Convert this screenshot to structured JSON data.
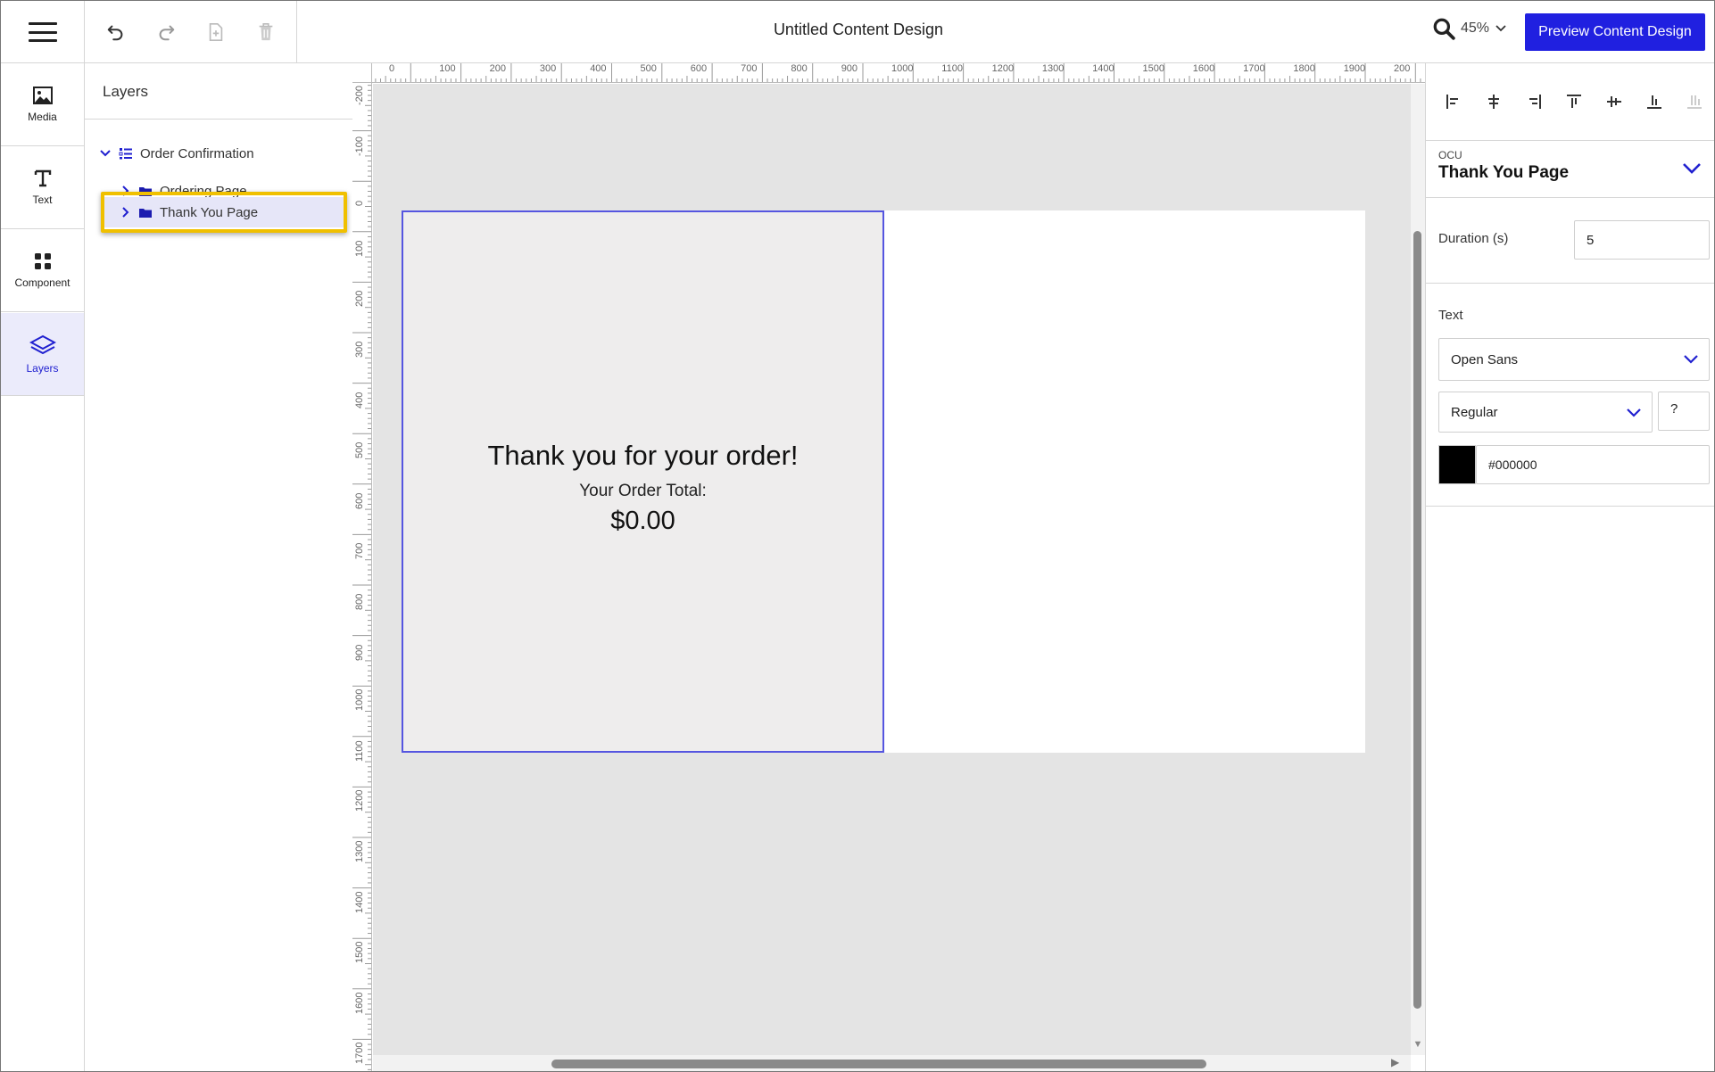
{
  "app": {
    "document_title": "Untitled Content Design",
    "zoom_level": "45%",
    "preview_button": "Preview Content Design"
  },
  "toolbar": {
    "undo_icon": "undo-icon",
    "redo_icon": "redo-icon",
    "new_page_icon": "new-page-icon",
    "delete_icon": "trash-icon"
  },
  "sidebar": {
    "items": [
      {
        "label": "Media",
        "icon": "image-icon"
      },
      {
        "label": "Text",
        "icon": "text-icon"
      },
      {
        "label": "Component",
        "icon": "grid-icon"
      },
      {
        "label": "Layers",
        "icon": "layers-icon",
        "active": true
      }
    ]
  },
  "layers_panel": {
    "title": "Layers",
    "tree": [
      {
        "label": "Order Confirmation",
        "expanded": true,
        "icon": "sequence-icon"
      },
      {
        "label": "Ordering Page",
        "expanded": false,
        "icon": "folder-icon"
      },
      {
        "label": "Thank You Page",
        "expanded": false,
        "icon": "folder-icon",
        "selected": true
      }
    ]
  },
  "rulers": {
    "horizontal": [
      "0",
      "0",
      "100",
      "200",
      "300",
      "400",
      "500",
      "600",
      "700",
      "800",
      "900",
      "1000",
      "1100",
      "1200",
      "1300",
      "1400",
      "1500",
      "1600",
      "1700",
      "1800",
      "1900",
      "200"
    ],
    "vertical": [
      "-200",
      "-100",
      "0",
      "100",
      "200",
      "300",
      "400",
      "500",
      "600",
      "700",
      "800",
      "900",
      "1000",
      "1100",
      "1200",
      "1300",
      "1400",
      "1500",
      "1600",
      "1700"
    ]
  },
  "canvas": {
    "heading": "Thank you for your order!",
    "total_label": "Your Order Total:",
    "total_value": "$0.00"
  },
  "properties": {
    "ocu_label": "OCU",
    "ocu_title": "Thank You Page",
    "duration_label": "Duration (s)",
    "duration_value": "5",
    "text_section_label": "Text",
    "font_family": "Open Sans",
    "font_weight": "Regular",
    "font_size": "?",
    "color_hex": "#000000"
  },
  "colors": {
    "accent": "#2020e0",
    "highlight": "#f0c000",
    "selection_border": "#5555e0",
    "canvas_bg": "#e4e4e4",
    "page_bg": "#eeeded"
  }
}
